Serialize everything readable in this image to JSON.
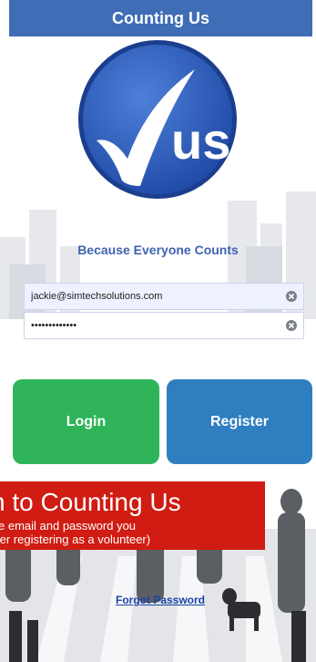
{
  "header": {
    "title": "Counting Us"
  },
  "logo": {
    "mark_text": "us",
    "tagline": "Because Everyone Counts"
  },
  "form": {
    "email": {
      "value": "jackie@simtechsolutions.com"
    },
    "password": {
      "value": "•••••••••••••"
    }
  },
  "buttons": {
    "login_label": "Login",
    "register_label": "Register"
  },
  "banner": {
    "title": "n to Counting Us",
    "line1": "e email and password you",
    "line2": "ter registering as a volunteer)"
  },
  "links": {
    "forgot_password": "Forgot Password"
  },
  "colors": {
    "header_bg": "#3f6db6",
    "login_green": "#2fb45a",
    "register_blue": "#2f7fc0",
    "banner_red": "#d01c12",
    "link_blue": "#1a44a6"
  }
}
